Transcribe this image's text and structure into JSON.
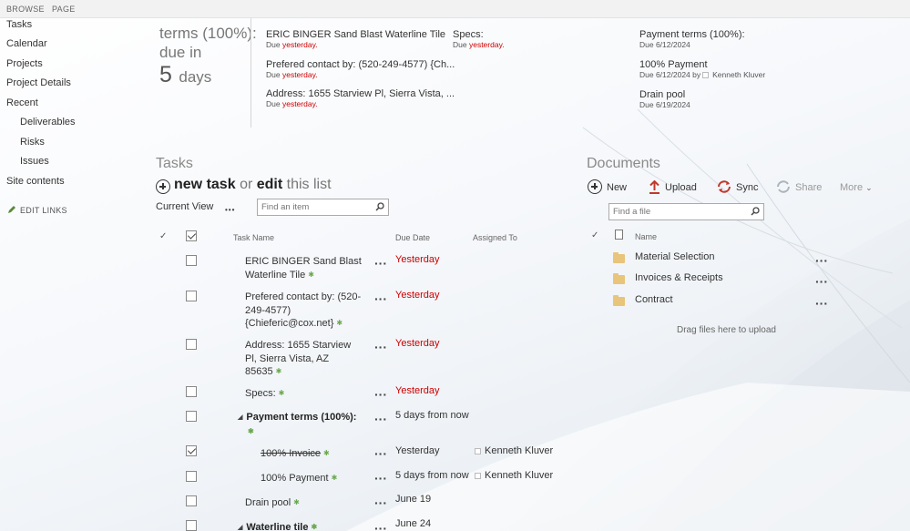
{
  "ribbon": {
    "tabs": [
      "BROWSE",
      "PAGE"
    ]
  },
  "nav": {
    "items": [
      "Tasks",
      "Calendar",
      "Projects",
      "Project Details",
      "Recent"
    ],
    "recent_items": [
      "Deliverables",
      "Risks",
      "Issues"
    ],
    "site_contents": "Site contents",
    "edit_links": "EDIT LINKS"
  },
  "summary": {
    "status_line1": "terms (100%):",
    "status_line2": "due in",
    "count": "5",
    "count_unit": "days"
  },
  "timeline": {
    "col1": [
      {
        "title": "ERIC BINGER Sand Blast Waterline Tile",
        "due_prefix": "Due ",
        "due_value": "yesterday."
      },
      {
        "title": "Prefered contact by: (520-249-4577) {Ch...",
        "due_prefix": "Due ",
        "due_value": "yesterday."
      },
      {
        "title": "Address: 1655 Starview Pl, Sierra Vista, ...",
        "due_prefix": "Due ",
        "due_value": "yesterday."
      }
    ],
    "col2": [
      {
        "title": "Specs:",
        "due_prefix": "Due ",
        "due_value": "yesterday."
      }
    ],
    "col3": [
      {
        "title": "Payment terms (100%):",
        "due": "Due 6/12/2024"
      },
      {
        "title": "100% Payment",
        "due": "Due 6/12/2024 by",
        "person": "Kenneth Kluver"
      },
      {
        "title": "Drain pool",
        "due": "Due 6/19/2024"
      }
    ]
  },
  "tasks": {
    "heading": "Tasks",
    "new_word": "new",
    "task_word": "task",
    "or_word": "or",
    "edit_word": "edit",
    "rest": "this list",
    "current_view": "Current View",
    "more_glyph": "•••",
    "search_placeholder": "Find an item",
    "columns": {
      "name": "Task Name",
      "due": "Due Date",
      "assigned": "Assigned To"
    },
    "rows": [
      {
        "name": "ERIC BINGER Sand Blast Waterline Tile",
        "due": "Yesterday",
        "overdue": true,
        "checked": false
      },
      {
        "name": "Prefered contact by: (520-249-4577) {Chieferic@cox.net}",
        "due": "Yesterday",
        "overdue": true,
        "checked": false
      },
      {
        "name": "Address: 1655 Starview Pl, Sierra Vista, AZ 85635",
        "due": "Yesterday",
        "overdue": true,
        "checked": false
      },
      {
        "name": "Specs:",
        "due": "Yesterday",
        "overdue": true,
        "checked": false
      },
      {
        "name": "Payment terms (100%):",
        "due": "5 days from now",
        "overdue": false,
        "checked": false,
        "group": true
      },
      {
        "name": "100% Invoice",
        "due": "Yesterday",
        "overdue": true,
        "checked": true,
        "assigned": "Kenneth Kluver",
        "sub": true
      },
      {
        "name": "100% Payment",
        "due": "5 days from now",
        "overdue": false,
        "checked": false,
        "assigned": "Kenneth Kluver",
        "sub": true
      },
      {
        "name": "Drain pool",
        "due": "June 19",
        "overdue": false,
        "checked": false
      },
      {
        "name": "Waterline tile",
        "due": "June 24",
        "overdue": false,
        "checked": false,
        "group": true
      }
    ]
  },
  "documents": {
    "heading": "Documents",
    "commands": {
      "new": "New",
      "upload": "Upload",
      "sync": "Sync",
      "share": "Share",
      "more": "More"
    },
    "search_placeholder": "Find a file",
    "column_name": "Name",
    "folders": [
      "Material Selection",
      "Invoices & Receipts",
      "Contract"
    ],
    "drag_text": "Drag files here to upload"
  },
  "colors": {
    "overdue": "#c00000",
    "folder": "#e8c57a",
    "star": "#6aa84f"
  }
}
